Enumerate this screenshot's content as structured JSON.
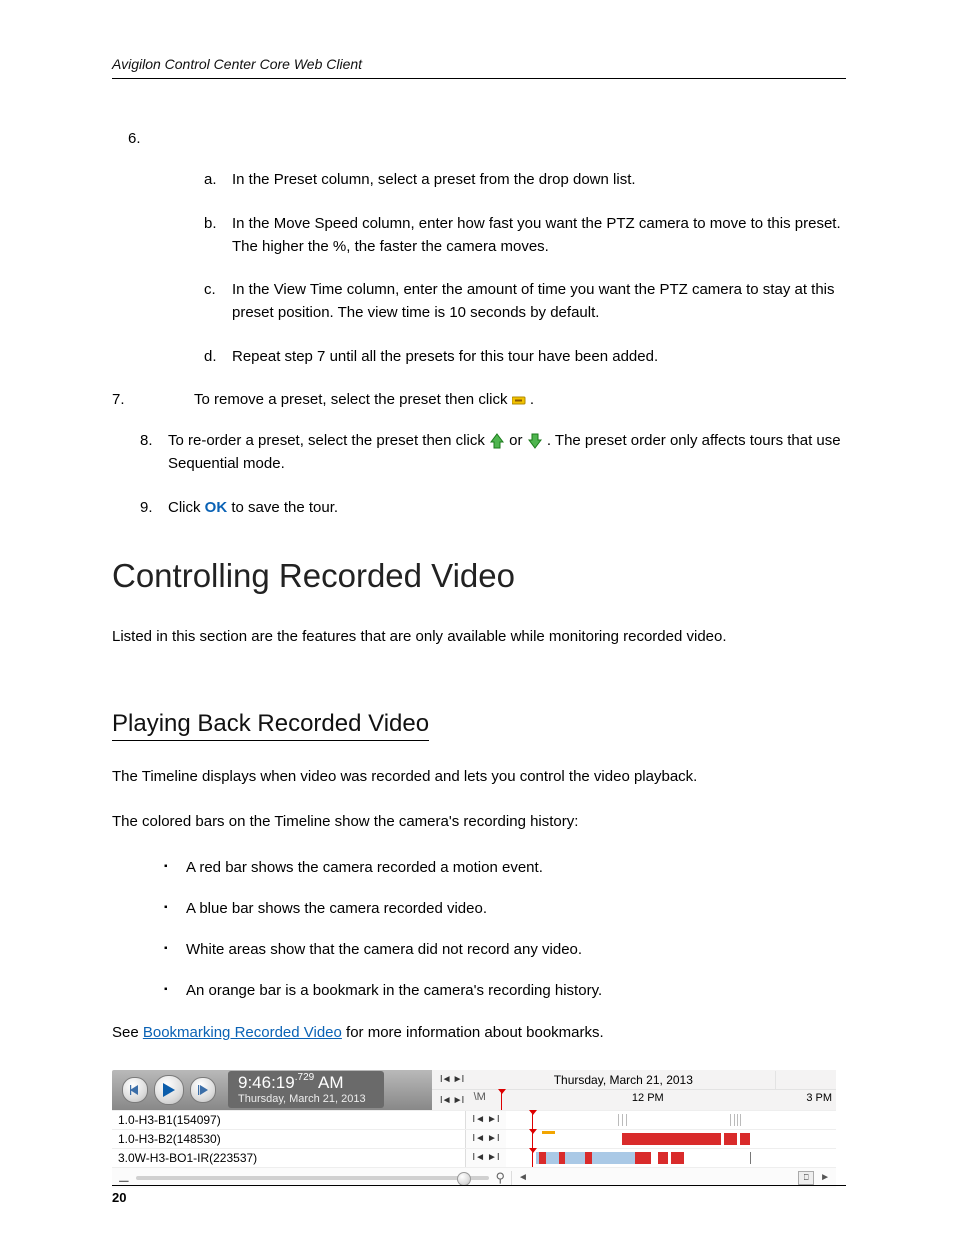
{
  "header": {
    "title": "Avigilon Control Center Core Web Client"
  },
  "steps": {
    "six_label": "6.",
    "six_sub": [
      {
        "l": "a.",
        "t": "In the Preset column, select a preset from the drop down list."
      },
      {
        "l": "b.",
        "t": "In the Move Speed column, enter how fast you want the PTZ camera to move to this preset. The higher the %, the faster the camera moves."
      },
      {
        "l": "c.",
        "t": "In the View Time column, enter the amount of time you want the PTZ camera to stay at this preset position. The view time is 10 seconds by default."
      },
      {
        "l": "d.",
        "t": "Repeat step 7 until all the presets for this tour have been added."
      }
    ],
    "seven_label": "7.",
    "seven_text_a": "To remove a preset, select the preset then click ",
    "seven_text_b": ".",
    "eight_label": "8.",
    "eight_a": "To re-order a preset, select the preset then click ",
    "eight_b": " or ",
    "eight_c": ". The preset order only affects tours that use Sequential mode.",
    "nine_label": "9.",
    "nine_a": "Click ",
    "nine_ok": "OK",
    "nine_b": " to save the tour."
  },
  "section": {
    "h1": "Controlling Recorded Video",
    "intro": "Listed in this section are the features that are only available while monitoring recorded video.",
    "h2": "Playing Back Recorded Video",
    "p1": "The Timeline displays when video was recorded and lets you control the video playback.",
    "p2": "The colored bars on the Timeline show the camera's recording history:",
    "bullets": [
      "A red bar shows the camera recorded a motion event.",
      "A blue bar shows the camera recorded video.",
      "White areas show that the camera did not record any video.",
      "An orange bar is a bookmark in the camera's recording history."
    ],
    "see_a": "See ",
    "see_link": "Bookmarking Recorded Video",
    "see_b": " for more information about bookmarks."
  },
  "timeline": {
    "time": "9:46:19",
    "ms": ".729",
    "ampm": " AM",
    "date": "Thursday, March 21, 2013",
    "head_date": "Thursday, March 21, 2013",
    "hour_12": "12 PM",
    "hour_3": "3 PM",
    "am_frag": "\\M",
    "cameras": [
      "1.0-H3-B1(154097)",
      "1.0-H3-B2(148530)",
      "3.0W-H3-BO1-IR(223537)"
    ]
  },
  "page_number": "20"
}
